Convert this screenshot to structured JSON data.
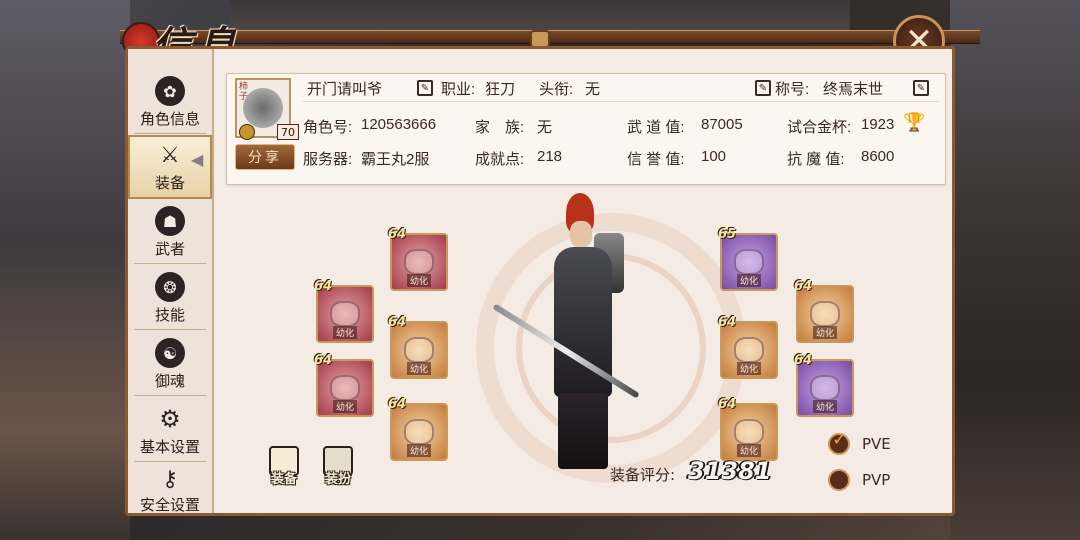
{
  "title": "信息",
  "sidebar": {
    "items": [
      {
        "label": "角色信息",
        "icon": "character-icon",
        "active": false
      },
      {
        "label": "装备",
        "icon": "sword-icon",
        "active": true
      },
      {
        "label": "武者",
        "icon": "warrior-icon",
        "active": false
      },
      {
        "label": "技能",
        "icon": "skill-icon",
        "active": false
      },
      {
        "label": "御魂",
        "icon": "soul-icon",
        "active": false
      },
      {
        "label": "基本设置",
        "icon": "gear-icon",
        "active": false
      },
      {
        "label": "安全设置",
        "icon": "security-icon",
        "active": false
      }
    ]
  },
  "profile": {
    "name": "开门请叫爷",
    "job_label": "职业:",
    "job_value": "狂刀",
    "rank_label": "头衔:",
    "rank_value": "无",
    "title_label": "称号:",
    "title_value": "终焉末世",
    "level": "70",
    "avatar_stamp": "柿子",
    "share_label": "分享",
    "role_id_label": "角色号:",
    "role_id": "120563666",
    "server_label": "服务器:",
    "server": "霸王丸2服",
    "clan_label": "家　族:",
    "clan": "无",
    "achievement_label": "成就点:",
    "achievement": "218",
    "martial_label": "武 道 值:",
    "martial": "87005",
    "reputation_label": "信 誉 值:",
    "reputation": "100",
    "trial_label": "试合金杯:",
    "trial": "1923",
    "resist_label": "抗 魔 值:",
    "resist": "8600"
  },
  "equipment": {
    "slots": [
      {
        "level": "64",
        "tag": "幼化",
        "color": "red",
        "name": "helmet-slot"
      },
      {
        "level": "64",
        "tag": "幼化",
        "color": "red",
        "name": "armor-slot"
      },
      {
        "level": "64",
        "tag": "幼化",
        "color": "orange",
        "name": "belt-slot"
      },
      {
        "level": "64",
        "tag": "幼化",
        "color": "red",
        "name": "pants-slot"
      },
      {
        "level": "64",
        "tag": "幼化",
        "color": "orange",
        "name": "boots-slot"
      },
      {
        "level": "65",
        "tag": "幼化",
        "color": "purple",
        "name": "weapon-slot"
      },
      {
        "level": "64",
        "tag": "幼化",
        "color": "orange",
        "name": "accessory-slot-1"
      },
      {
        "level": "64",
        "tag": "幼化",
        "color": "orange",
        "name": "accessory-slot-2"
      },
      {
        "level": "64",
        "tag": "幼化",
        "color": "purple",
        "name": "accessory-slot-3"
      },
      {
        "level": "64",
        "tag": "幼化",
        "color": "orange",
        "name": "accessory-slot-4"
      }
    ],
    "mode_equip": "装备",
    "mode_outfit": "装扮",
    "score_label": "装备评分:",
    "score": "31381"
  },
  "modes": {
    "pve": "PVE",
    "pvp": "PVP",
    "pve_selected": true
  }
}
